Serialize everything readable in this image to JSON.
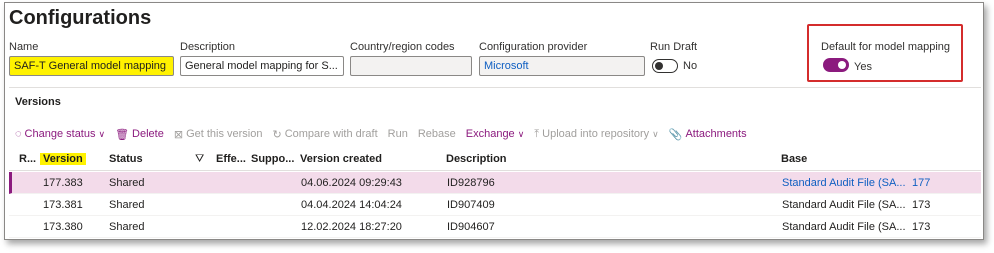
{
  "page": {
    "title": "Configurations"
  },
  "fields": {
    "name": {
      "label": "Name",
      "value": "SAF-T General model mapping"
    },
    "description": {
      "label": "Description",
      "value": "General model mapping for S..."
    },
    "country": {
      "label": "Country/region codes",
      "value": ""
    },
    "provider": {
      "label": "Configuration provider",
      "value": "Microsoft"
    },
    "run_draft": {
      "label": "Run Draft",
      "state": "No"
    },
    "default_mapping": {
      "label": "Default for model mapping",
      "state": "Yes"
    }
  },
  "versions": {
    "title": "Versions",
    "toolbar": {
      "change_status": "Change status",
      "delete": "Delete",
      "get_version": "Get this version",
      "compare": "Compare with draft",
      "run": "Run",
      "rebase": "Rebase",
      "exchange": "Exchange",
      "upload": "Upload into repository",
      "attachments": "Attachments"
    },
    "columns": {
      "r": "R...",
      "version": "Version",
      "status": "Status",
      "effective": "Effe...",
      "supported": "Suppo...",
      "created": "Version created",
      "description": "Description",
      "base": "Base"
    },
    "rows": [
      {
        "version": "177.383",
        "status": "Shared",
        "created": "04.06.2024 09:29:43",
        "description": "ID928796",
        "base": "Standard Audit File (SA...",
        "base_version": "177",
        "selected": true
      },
      {
        "version": "173.381",
        "status": "Shared",
        "created": "04.04.2024 14:04:24",
        "description": "ID907409",
        "base": "Standard Audit File (SA...",
        "base_version": "173",
        "selected": false
      },
      {
        "version": "173.380",
        "status": "Shared",
        "created": "12.02.2024 18:27:20",
        "description": "ID904607",
        "base": "Standard Audit File (SA...",
        "base_version": "173",
        "selected": false
      }
    ]
  },
  "colors": {
    "accent": "#8b1a7e",
    "highlight": "#fff200",
    "link": "#0f5fc2",
    "callout": "#d42c2c"
  }
}
